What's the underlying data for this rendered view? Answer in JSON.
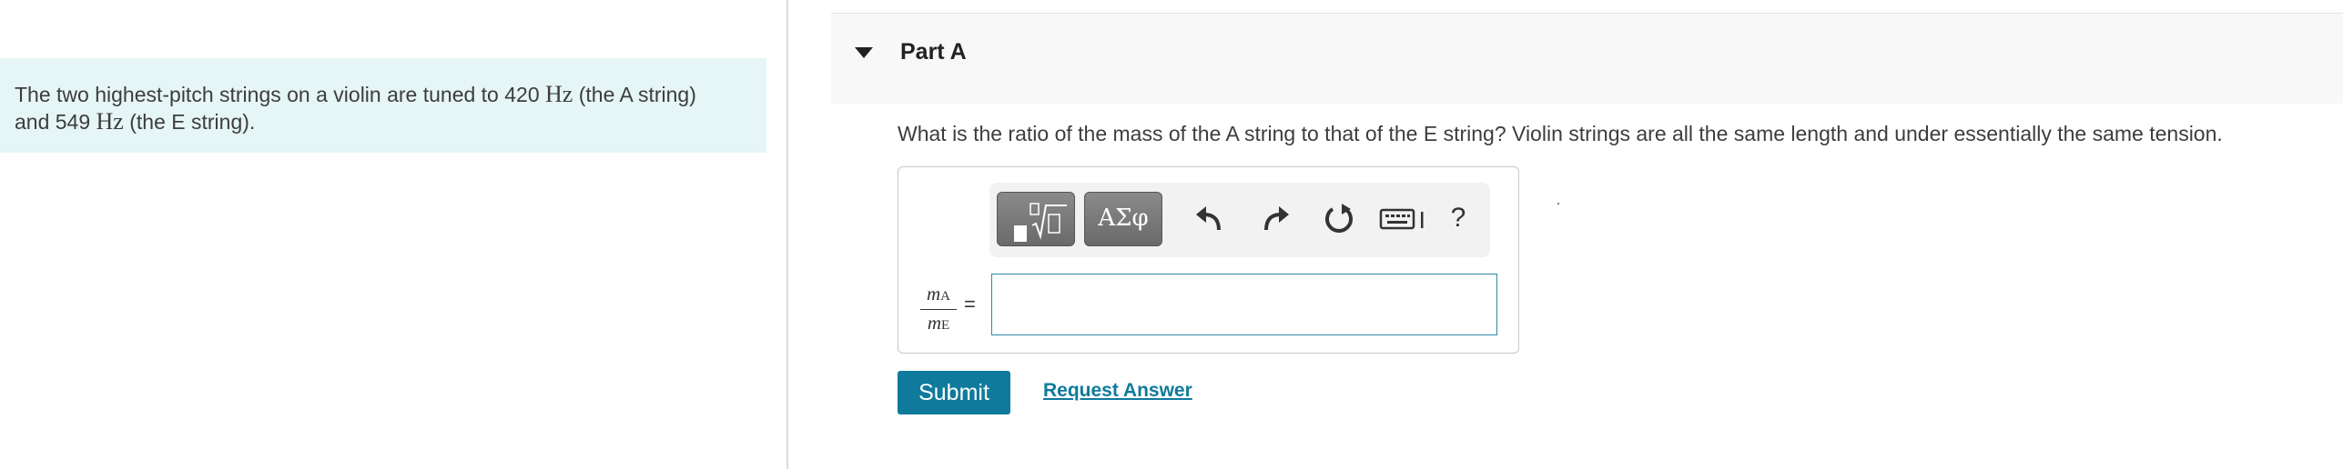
{
  "problem": {
    "intro_part1": "The two highest-pitch strings on a violin are tuned to 420 ",
    "unit1": "Hz",
    "intro_part2": " (the A string)",
    "intro_part3": "and 549 ",
    "unit2": "Hz",
    "intro_part4": " (the E string)."
  },
  "part": {
    "title": "Part A",
    "question": "What is the ratio of the mass of the A string to that of the E string? Violin strings are all the same length and under essentially the same tension."
  },
  "answer": {
    "numerator_var": "m",
    "numerator_sub": "A",
    "denominator_var": "m",
    "denominator_sub": "E",
    "equals": "=",
    "value": ""
  },
  "toolbar": {
    "symbols_label": "ΑΣφ",
    "help_label": "?",
    "icons": [
      "templates-icon",
      "symbols-icon",
      "undo-icon",
      "redo-icon",
      "reset-icon",
      "keyboard-icon",
      "help-icon"
    ]
  },
  "actions": {
    "submit_label": "Submit",
    "request_answer_label": "Request Answer"
  },
  "colors": {
    "accent": "#0f7a9c",
    "intro_background": "#e6f5f5",
    "input_border": "#2f87a8",
    "toolbar_button": "#777777"
  }
}
